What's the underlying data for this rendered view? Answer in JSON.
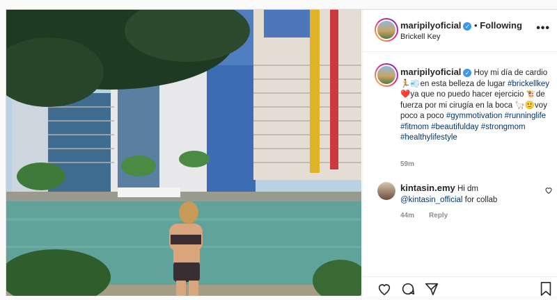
{
  "post": {
    "username": "maripilyoficial",
    "following_label": "Following",
    "separator": "•",
    "location": "Brickell Key",
    "more_label": "•••"
  },
  "caption": {
    "username": "maripilyoficial",
    "text_1": "Hoy mi día de cardio 🏃💨en esta belleza de lugar ",
    "tag_1": "#brickellkey",
    "text_2": " ❤️ya que no puedo hacer ejercicio 🐮de fuerza por mi cirugía en la boca 🦙🙂voy poco a poco ",
    "tags": "#gymmotivation #runninglife #fitmom #beautifulday #strongmom #healthylifestyle",
    "time": "59m"
  },
  "comment": {
    "username": "kintasin.emy",
    "text_1": "Hi dm ",
    "mention": "@kintasin_official",
    "text_2": " for collab",
    "time": "44m",
    "reply_label": "Reply"
  },
  "colors": {
    "link": "#00376b",
    "verified": "#3897f0",
    "meta": "#8e8e8e"
  },
  "icons": [
    "heart-icon",
    "comment-icon",
    "share-icon",
    "bookmark-icon",
    "small-heart-icon",
    "more-icon",
    "verified-badge-icon"
  ]
}
